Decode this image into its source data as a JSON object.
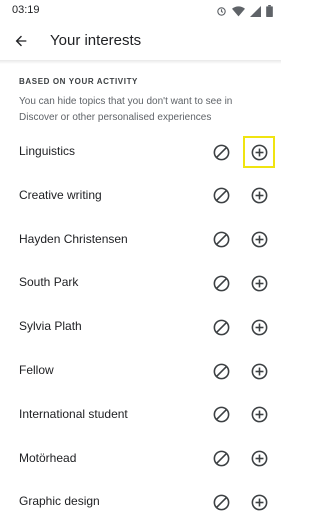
{
  "status_bar": {
    "time": "03:19",
    "icons": [
      "sync-icon",
      "wifi-icon",
      "signal-icon",
      "battery-icon"
    ]
  },
  "header": {
    "back_icon": "arrow-back-icon",
    "title": "Your interests"
  },
  "section": {
    "title": "BASED ON YOUR ACTIVITY",
    "description": "You can hide topics that you don't want to see in Discover or other personalised experiences"
  },
  "topics": [
    {
      "label": "Linguistics",
      "focused": true
    },
    {
      "label": "Creative writing",
      "focused": false
    },
    {
      "label": "Hayden Christensen",
      "focused": false
    },
    {
      "label": "South Park",
      "focused": false
    },
    {
      "label": "Sylvia Plath",
      "focused": false
    },
    {
      "label": "Fellow",
      "focused": false
    },
    {
      "label": "International student",
      "focused": false
    },
    {
      "label": "Motörhead",
      "focused": false
    },
    {
      "label": "Graphic design",
      "focused": false
    }
  ],
  "colors": {
    "icon": "#3c4043",
    "focus_outline": "#f0e410"
  }
}
